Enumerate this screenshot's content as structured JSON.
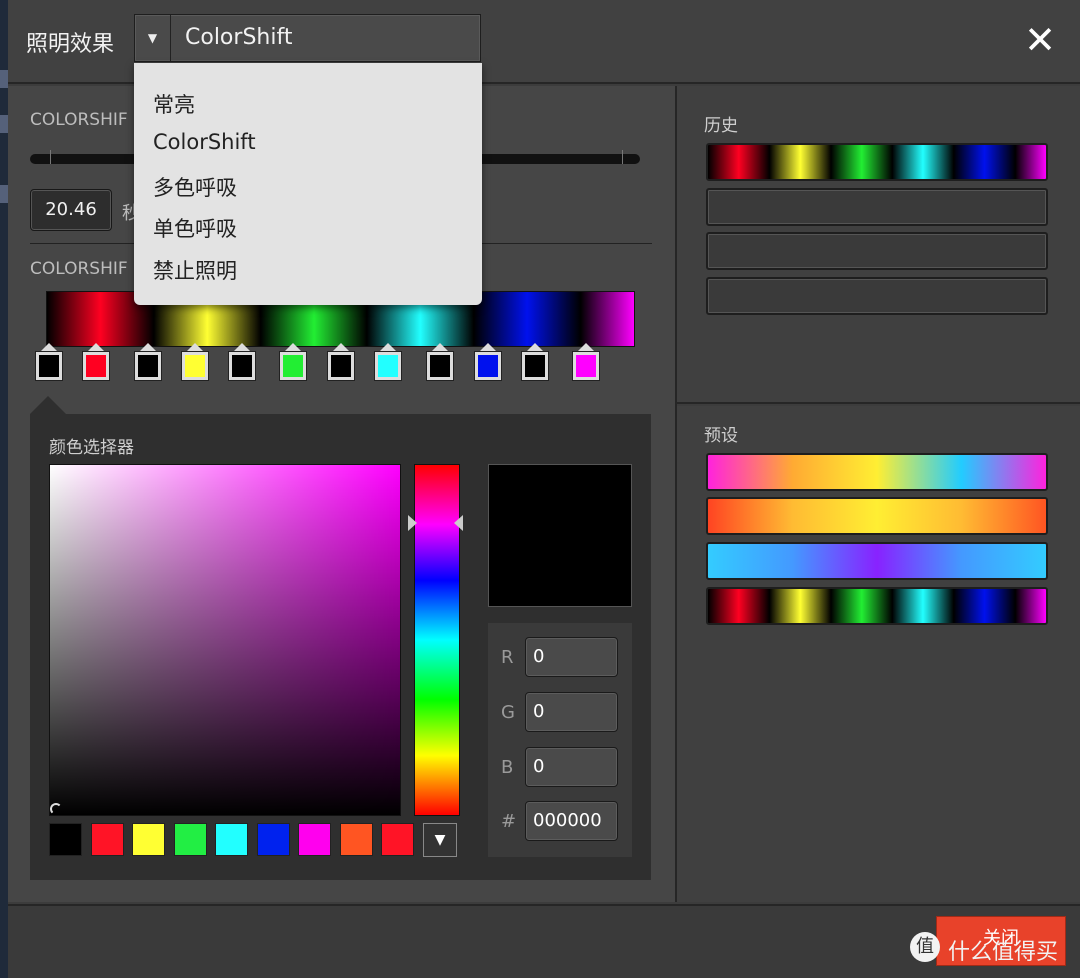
{
  "header": {
    "title": "照明效果",
    "effect_selected": "ColorShift",
    "close_icon": "close-icon"
  },
  "dropdown": {
    "options": [
      "常亮",
      "ColorShift",
      "多色呼吸",
      "单色呼吸",
      "禁止照明"
    ]
  },
  "speed": {
    "section_label": "COLORSHIF",
    "value": "20.46",
    "unit": "秒"
  },
  "gradient": {
    "section_label": "COLORSHIF",
    "stops": [
      "#000000",
      "#ff0021",
      "#000000",
      "#ffff33",
      "#000000",
      "#22ee33",
      "#000000",
      "#22ffff",
      "#000000",
      "#0011ee",
      "#000000",
      "#ff00ff"
    ]
  },
  "picker": {
    "title": "颜色选择器",
    "hue_color": "#ff00ff",
    "preview_color": "#000000",
    "r_label": "R",
    "r_value": "0",
    "g_label": "G",
    "g_value": "0",
    "b_label": "B",
    "b_value": "0",
    "hex_label": "#",
    "hex_value": "000000",
    "swatches": [
      "#000000",
      "#ff1426",
      "#ffff33",
      "#22ee44",
      "#22ffff",
      "#0022ee",
      "#ff00ee",
      "#ff5522",
      "#ff1426"
    ]
  },
  "history": {
    "title": "历史"
  },
  "presets": {
    "title": "预设"
  },
  "footer": {
    "close_label": "关闭",
    "watermark": "什么值得买",
    "watermark_glyph": "值"
  }
}
